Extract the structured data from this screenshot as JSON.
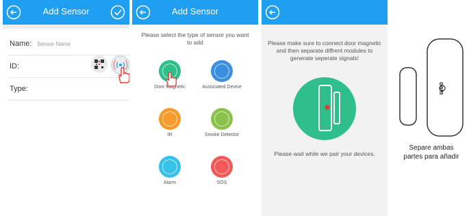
{
  "screen1": {
    "title": "Add Sensor",
    "name_label": "Name:",
    "name_placeholder": "Sensor Name",
    "id_label": "ID:",
    "type_label": "Type:"
  },
  "screen2": {
    "title": "Add Sensor",
    "prompt": "Please select the type of sensor you want to add",
    "sensors": [
      {
        "label": "Door Magnetic",
        "color": "#2fbf8a"
      },
      {
        "label": "Associated Device",
        "color": "#3b8fe0"
      },
      {
        "label": "IR",
        "color": "#f59b2b"
      },
      {
        "label": "Smoke Detector",
        "color": "#8bc34a"
      },
      {
        "label": "Alarm",
        "color": "#35c1e8"
      },
      {
        "label": "SOS",
        "color": "#f25a5a"
      }
    ]
  },
  "screen3": {
    "message": "Please make sure to connect door magnetic and then separate diffrent modules to generate seperate signals!",
    "wait": "Please wait while we pair your devices."
  },
  "device": {
    "brand": "oam",
    "caption_line1": "Separe ambas",
    "caption_line2": "partes para añadir"
  },
  "colors": {
    "header": "#1e9ff2",
    "green_circle": "#2fbf8a",
    "indicator": "#e53935"
  }
}
